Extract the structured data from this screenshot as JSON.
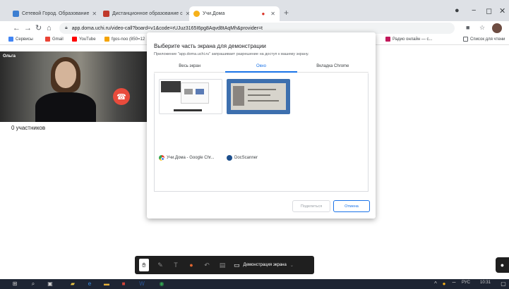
{
  "browser": {
    "tabs": [
      {
        "label": "Сетевой Город. Образование",
        "color": "#3c7ed1"
      },
      {
        "label": "Дистанционное образование с",
        "color": "#c0392b"
      },
      {
        "label": "Учи.Дома",
        "color": "#f6b11a"
      }
    ],
    "new_tab": "+",
    "url": "app.doma.uchi.ru/video-call?board=v1&code=rUJuz3165I6pg8Aqvd8tAqMh&provider=t",
    "bookmarks": [
      {
        "label": "Сервисы",
        "color": "#4285f4"
      },
      {
        "label": "Gmail",
        "color": "#ea4335"
      },
      {
        "label": "YouTube",
        "color": "#ff0000"
      },
      {
        "label": "fgos-noo (850=12",
        "color": "#f4a300"
      }
    ],
    "bookmarks_right": [
      {
        "label": "Радио онлайн — с...",
        "color": "#c2185b"
      },
      {
        "label": "Список для чтени",
        "color": "#5f6368"
      }
    ]
  },
  "call": {
    "user_name": "Ольга",
    "participants": "0 участников"
  },
  "dialog": {
    "title": "Выберите часть экрана для демонстрации",
    "subtitle": "Приложение \"app.doma.uchi.ru\" запрашивает разрешение на доступ к вашему экрану.",
    "tabs": [
      "Весь экран",
      "Окно",
      "Вкладка Chrome"
    ],
    "active_tab": 1,
    "windows": [
      {
        "label": "Учи.Дома - Google Chr..."
      },
      {
        "label": "DocScanner"
      }
    ],
    "share_button": "Поделиться",
    "cancel_button": "Отмена"
  },
  "toolbar": {
    "screen_share_label": "Демонстрация экрана"
  },
  "taskbar": {
    "lang": "РУС",
    "time": "10:31"
  }
}
